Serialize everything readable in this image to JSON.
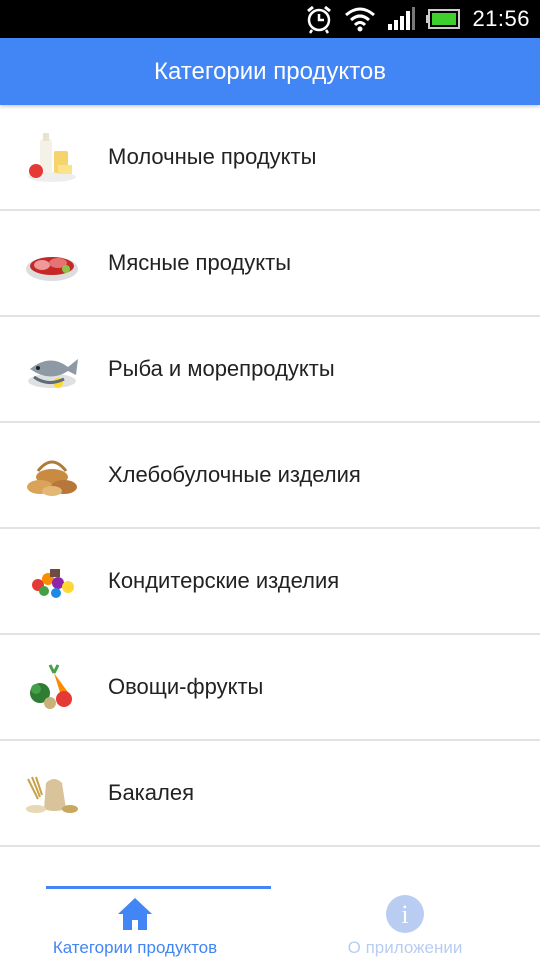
{
  "status_bar": {
    "time": "21:56",
    "icons": [
      "alarm-icon",
      "wifi-icon",
      "signal-icon",
      "battery-icon"
    ]
  },
  "app_bar": {
    "title": "Категории продуктов"
  },
  "categories": [
    {
      "label": "Молочные продукты",
      "icon": "dairy-icon"
    },
    {
      "label": "Мясные продукты",
      "icon": "meat-icon"
    },
    {
      "label": "Рыба и морепродукты",
      "icon": "fish-icon"
    },
    {
      "label": "Хлебобулочные изделия",
      "icon": "bread-icon"
    },
    {
      "label": "Кондитерские изделия",
      "icon": "sweets-icon"
    },
    {
      "label": "Овощи-фрукты",
      "icon": "vegetables-icon"
    },
    {
      "label": "Бакалея",
      "icon": "grocery-icon"
    }
  ],
  "bottom_nav": {
    "tabs": [
      {
        "label": "Категории продуктов",
        "icon": "home-icon",
        "active": true
      },
      {
        "label": "О приложении",
        "icon": "info-icon",
        "active": false
      }
    ]
  },
  "colors": {
    "primary": "#4285f4",
    "inactive": "#b9cdf2",
    "divider": "#e2e2e2",
    "status_bar": "#000000"
  }
}
